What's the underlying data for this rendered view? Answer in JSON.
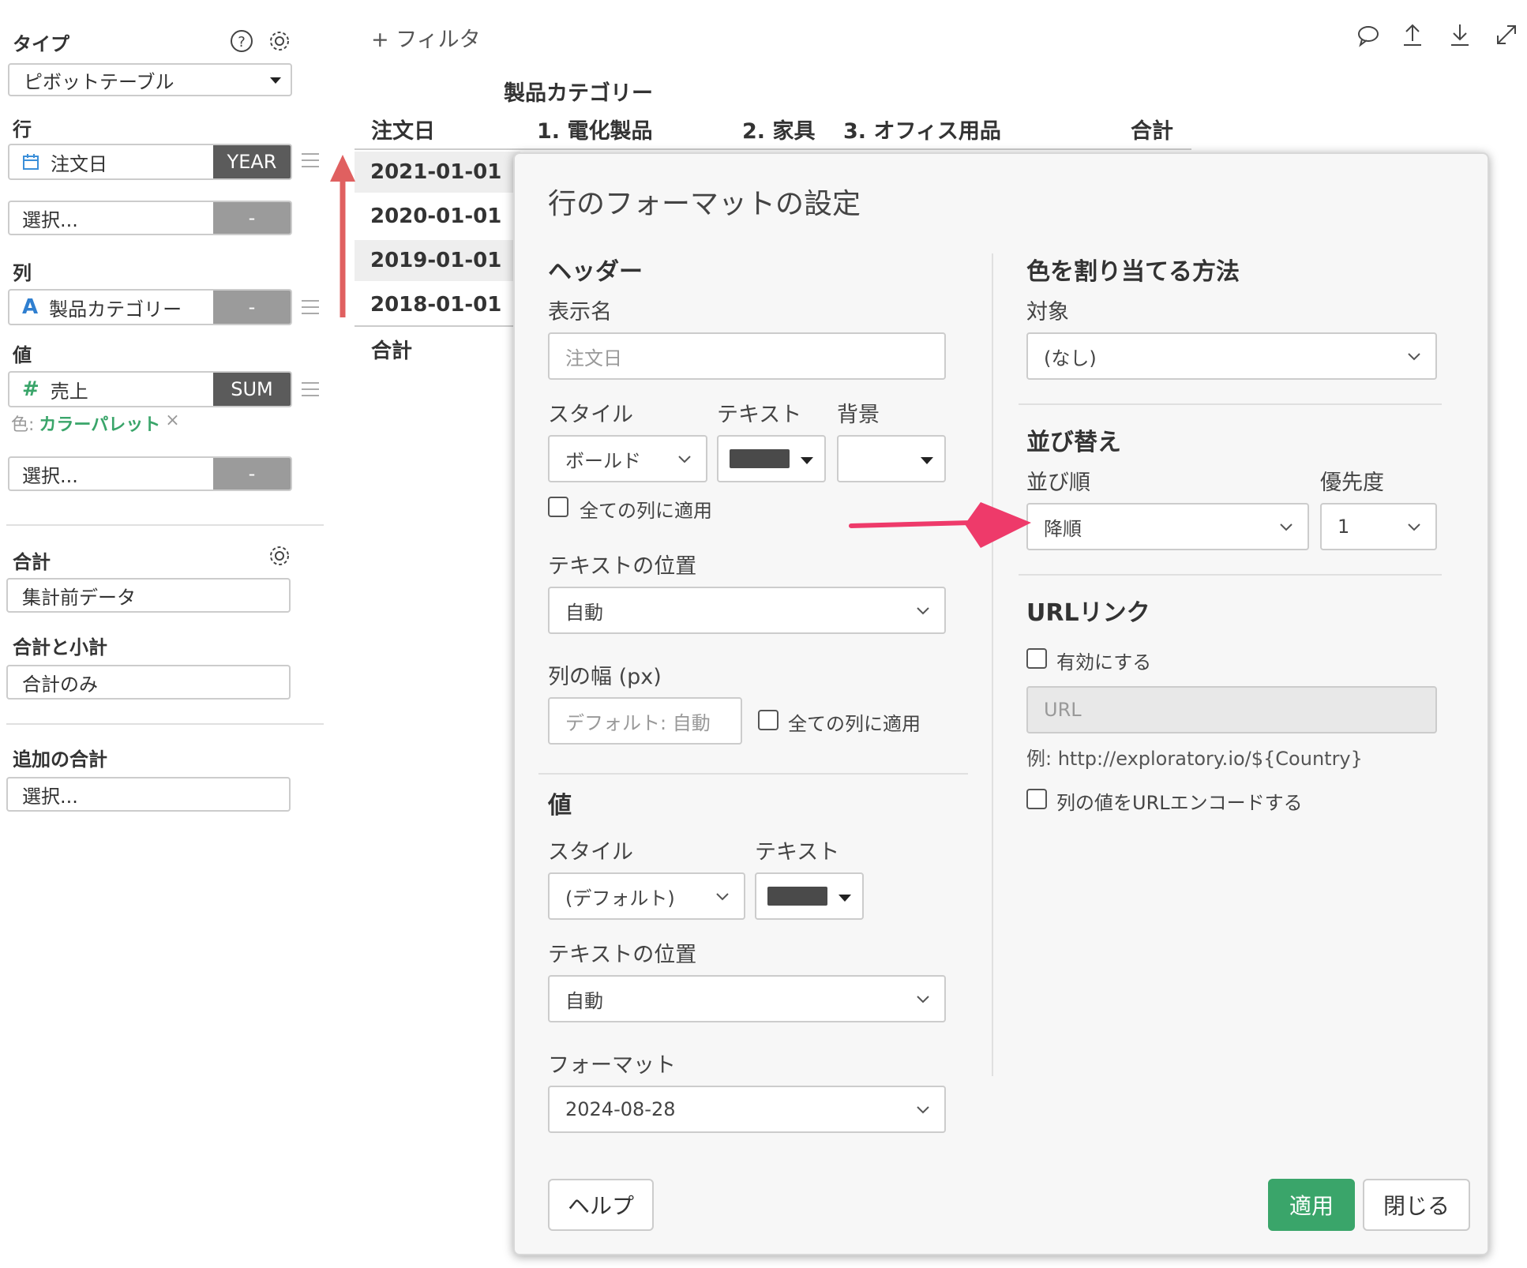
{
  "sidebar": {
    "type_label": "タイプ",
    "type_value": "ピボットテーブル",
    "row_label": "行",
    "row_field": "注文日",
    "row_agg": "YEAR",
    "row_select": "選択...",
    "row_select_tag": "-",
    "col_label": "列",
    "col_field": "製品カテゴリー",
    "col_tag": "-",
    "val_label": "値",
    "val_field": "売上",
    "val_agg": "SUM",
    "color_prefix": "色:",
    "color_value": "カラーパレット",
    "color_remove": "×",
    "val_select": "選択...",
    "val_select_tag": "-",
    "total_label": "合計",
    "total_value": "集計前データ",
    "subtotal_label": "合計と小計",
    "subtotal_value": "合計のみ",
    "extra_total_label": "追加の合計",
    "extra_total_value": "選択..."
  },
  "toolbar": {
    "filter_label": "+ フィルタ"
  },
  "table": {
    "column_group_header": "製品カテゴリー",
    "row_header": "注文日",
    "columns": [
      "1. 電化製品",
      "2. 家具",
      "3. オフィス用品",
      "合計"
    ],
    "rows": [
      "2021-01-01",
      "2020-01-01",
      "2019-01-01",
      "2018-01-01"
    ],
    "total_row": "合計"
  },
  "dialog": {
    "title": "行のフォーマットの設定",
    "header_section": "ヘッダー",
    "display_name_label": "表示名",
    "display_name_placeholder": "注文日",
    "style_label": "スタイル",
    "text_label": "テキスト",
    "bg_label": "背景",
    "style_value": "ボールド",
    "apply_all_cols": "全ての列に適用",
    "text_pos_label": "テキストの位置",
    "text_pos_value": "自動",
    "col_width_label": "列の幅 (px)",
    "col_width_placeholder": "デフォルト: 自動",
    "col_width_apply_all": "全ての列に適用",
    "value_section": "値",
    "value_style_label": "スタイル",
    "value_text_label": "テキスト",
    "value_style_value": "(デフォルト)",
    "value_text_pos_label": "テキストの位置",
    "value_text_pos_value": "自動",
    "format_label": "フォーマット",
    "format_value": "2024-08-28",
    "color_assign_section": "色を割り当てる方法",
    "target_label": "対象",
    "target_value": "(なし)",
    "sort_section": "並び替え",
    "sort_order_label": "並び順",
    "sort_priority_label": "優先度",
    "sort_order_value": "降順",
    "sort_priority_value": "1",
    "url_section": "URLリンク",
    "url_enable": "有効にする",
    "url_placeholder": "URL",
    "url_example": "例: http://exploratory.io/${Country}",
    "url_encode": "列の値をURLエンコードする",
    "help_button": "ヘルプ",
    "apply_button": "適用",
    "close_button": "閉じる"
  },
  "colors": {
    "accent_green": "#3aa56a",
    "annotation_red": "#e06060",
    "annotation_pink": "#ee3a6a",
    "calendar_blue": "#3b8fd9",
    "string_blue": "#2f7fd0",
    "number_green": "#3aa56a"
  }
}
